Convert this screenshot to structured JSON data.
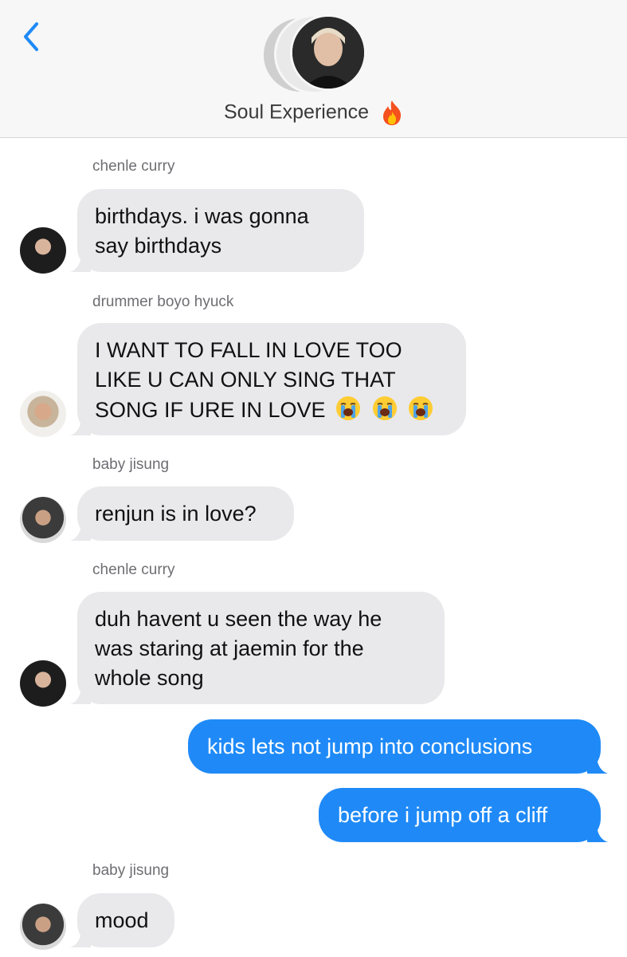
{
  "header": {
    "title": "Soul Experience",
    "title_emoji": "fire-icon",
    "accent": "#1f8af7"
  },
  "messages": [
    {
      "sender": "chenle curry",
      "text": "birthdays. i was gonna say birthdays"
    },
    {
      "sender": "drummer boyo hyuck",
      "text_lines": [
        "I WANT TO FALL IN LOVE TOO",
        "LIKE U CAN ONLY SING THAT",
        "SONG IF URE IN LOVE"
      ],
      "emoji": "loudly-crying-face-icon ×3"
    },
    {
      "sender": "baby jisung",
      "text": "renjun is in love?"
    },
    {
      "sender": "chenle curry",
      "text": "duh havent u seen the way he was staring at jaemin for the whole song"
    },
    {
      "sender": "me",
      "text": "kids lets not jump into conclusions"
    },
    {
      "sender": "me",
      "text": "before i jump off a cliff"
    },
    {
      "sender": "baby jisung",
      "text": "mood"
    }
  ],
  "colors": {
    "incoming_bubble": "#e9e9eb",
    "outgoing_bubble": "#1f8af7",
    "sender_label": "#6e6e73"
  }
}
